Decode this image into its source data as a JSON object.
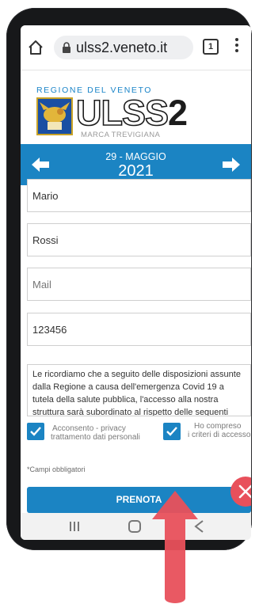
{
  "browser": {
    "url": "ulss2.veneto.it",
    "tab_count": "1",
    "icons": [
      "home-icon",
      "lock-icon",
      "tabs-icon",
      "menu-icon"
    ]
  },
  "header": {
    "region": "REGIONE DEL VENETO",
    "logo_prefix": "ULSS",
    "logo_number": "2",
    "logo_sub": "MARCA TREVIGIANA"
  },
  "date_bar": {
    "day_month": "29 - MAGGIO",
    "year": "2021"
  },
  "form": {
    "first_name": "Mario",
    "last_name": "Rossi",
    "mail_placeholder": "Mail",
    "code": "123456",
    "notice": "Le ricordiamo che a seguito delle disposizioni assunte dalla Regione a causa dell'emergenza Covid 19 a tutela della salute pubblica, l'accesso alla nostra struttura sarà subordinato al rispetto delle seguenti regole:",
    "consent_privacy_line1": "Acconsento - privacy",
    "consent_privacy_line2": "trattamento dati personali",
    "consent_rules_line1": "Ho compreso",
    "consent_rules_line2": "i criteri di accesso",
    "required_note": "*Campi obbligatori",
    "submit_label": "PRENOTA"
  },
  "colors": {
    "accent": "#1b84c3",
    "close_badge": "#e8505b",
    "hint_arrow": "#e8505b"
  }
}
